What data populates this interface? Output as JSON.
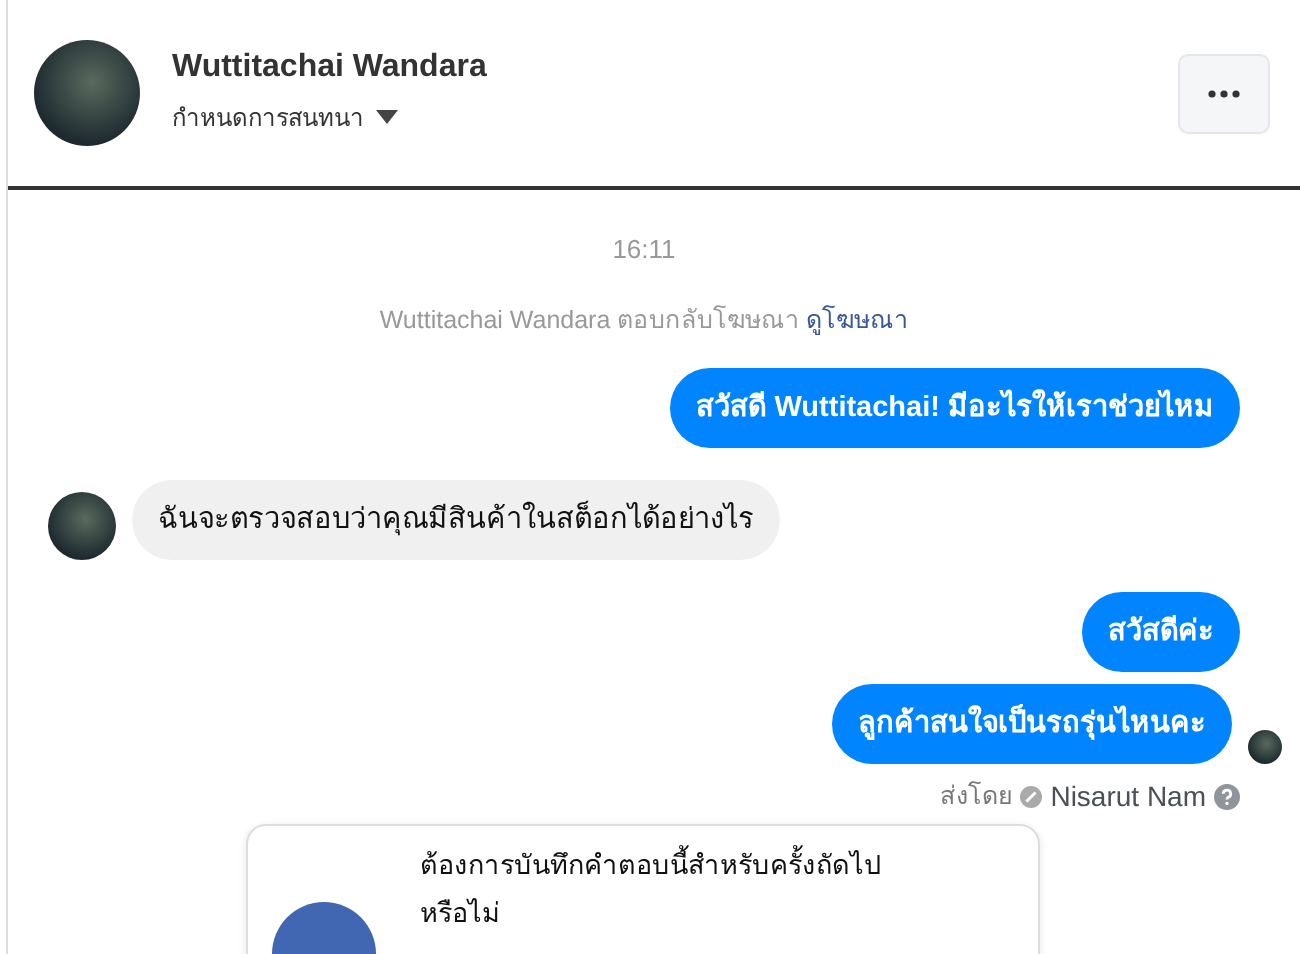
{
  "header": {
    "name": "Wuttitachai Wandara",
    "subtitle": "กำหนดการสนทนา"
  },
  "timestamp": "16:11",
  "system_note": {
    "text": "Wuttitachai Wandara ตอบกลับโฆษณา",
    "link": "ดูโฆษณา"
  },
  "messages": [
    {
      "kind": "sent",
      "text": "สวัสดี Wuttitachai! มีอะไรให้เราช่วยไหม"
    },
    {
      "kind": "received",
      "text": "ฉันจะตรวจสอบว่าคุณมีสินค้าในสต็อกได้อย่างไร"
    },
    {
      "kind": "sent",
      "text": "สวัสดีค่ะ"
    },
    {
      "kind": "sent",
      "text": "ลูกค้าสนใจเป็นรถรุ่นไหนคะ",
      "seen": true
    }
  ],
  "sent_by": {
    "label": "ส่งโดย",
    "name": "Nisarut Nam"
  },
  "prompt_card": {
    "text": "ต้องการบันทึกคำตอบนี้สำหรับครั้งถัดไปหรือไม่"
  }
}
